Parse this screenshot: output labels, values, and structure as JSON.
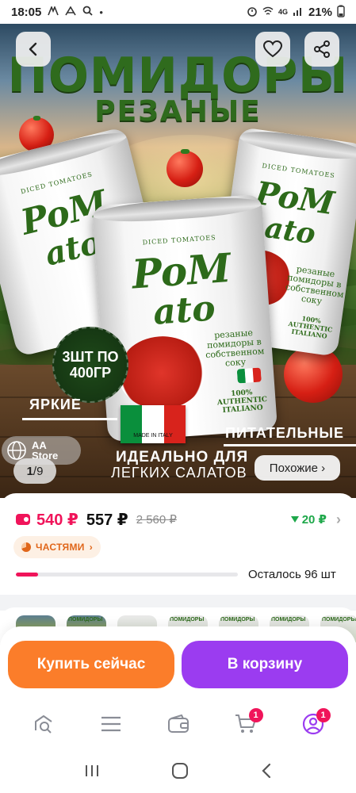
{
  "status_bar": {
    "time": "18:05",
    "network": "4G",
    "battery": "21%"
  },
  "hero": {
    "headline": "ПОМИДОРЫ",
    "subheadline": "РЕЗАНЫЕ",
    "can_top_label": "DICED TOMATOES",
    "can_brand_line1": "PoM",
    "can_brand_line2": "ato",
    "can_description": "резаные помидоры в собственном соку",
    "can_stamp": "100% AUTHENTIC ITALIANO",
    "pack_badge_line1": "3ШТ ПО",
    "pack_badge_line2": "400ГР",
    "made_in": "MADE IN ITALY",
    "caption_bright": "ЯРКИЕ",
    "caption_nutritious": "ПИТАТЕЛЬНЫЕ",
    "caption_ideal_line1": "ИДЕАЛЬНО ДЛЯ",
    "caption_ideal_line2": "ЛЕГКИХ САЛАТОВ",
    "store_chip_line1": "AA",
    "store_chip_line2": "Store",
    "pager_current": "1",
    "pager_total": "9",
    "pager_sep": "/",
    "similar_label": "Похожие ›",
    "flag_colors": [
      "#0a8f3c",
      "#ffffff",
      "#d8231c"
    ]
  },
  "price": {
    "wallet_price": "540 ₽",
    "regular_price": "557 ₽",
    "old_price": "2 560 ₽",
    "bonus": "20 ₽",
    "installments_label": "ЧАСТЯМИ",
    "stock_progress": 0.1,
    "stock_left": "Осталось 96 шт",
    "accent_color": "#f0145a"
  },
  "thumbnails": [
    {
      "label": "",
      "style": "dark"
    },
    {
      "label": "ПОМИДОРЫ",
      "style": "dark"
    },
    {
      "label": "",
      "style": "light"
    },
    {
      "label": "ПОМИДОРЫ",
      "style": "light"
    },
    {
      "label": "ПОМИДОРЫ",
      "style": "light"
    },
    {
      "label": "ПОМИДОРЫ",
      "style": "light"
    },
    {
      "label": "ПОМИДОРЫ",
      "style": "light"
    }
  ],
  "actions": {
    "buy_now": "Купить сейчас",
    "add_to_cart": "В корзину",
    "buy_color": "#fb7d2a",
    "cart_color": "#9b3cf0"
  },
  "tabbar": {
    "items": [
      {
        "name": "search-home-icon"
      },
      {
        "name": "catalog-icon"
      },
      {
        "name": "wallet-icon"
      },
      {
        "name": "cart-icon",
        "badge": "1"
      },
      {
        "name": "profile-icon",
        "badge": "1"
      }
    ]
  }
}
